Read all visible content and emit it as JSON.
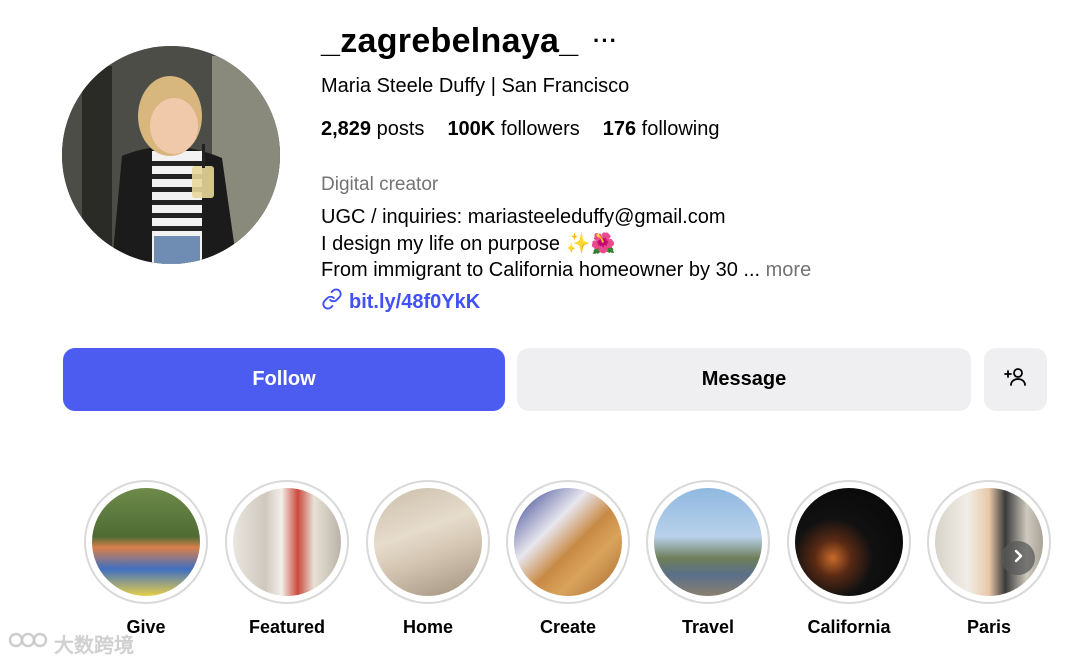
{
  "profile": {
    "username": "_zagrebelnaya_",
    "more_icon": "more-horizontal-icon",
    "full_name": "Maria Steele Duffy | San Francisco",
    "stats": [
      {
        "count": "2,829",
        "label": "posts"
      },
      {
        "count": "100K",
        "label": "followers"
      },
      {
        "count": "176",
        "label": "following"
      }
    ],
    "category": "Digital creator",
    "bio_lines": [
      "UGC / inquiries: mariasteeleduffy@gmail.com",
      "I design my life on purpose ✨🌺",
      "From immigrant to California homeowner by 30 ..."
    ],
    "bio_more": "more",
    "link": "bit.ly/48f0YkK",
    "link_icon": "link-icon"
  },
  "actions": {
    "follow_label": "Follow",
    "message_label": "Message",
    "add_user_icon": "add-user-icon"
  },
  "highlights": [
    {
      "label": "Give"
    },
    {
      "label": "Featured"
    },
    {
      "label": "Home"
    },
    {
      "label": "Create"
    },
    {
      "label": "Travel"
    },
    {
      "label": "California"
    },
    {
      "label": "Paris"
    }
  ],
  "watermark": "大数跨境",
  "colors": {
    "follow_bg": "#4d5cf0",
    "secondary_bg": "#efeff1",
    "link": "#4150f7",
    "muted": "#737373"
  }
}
